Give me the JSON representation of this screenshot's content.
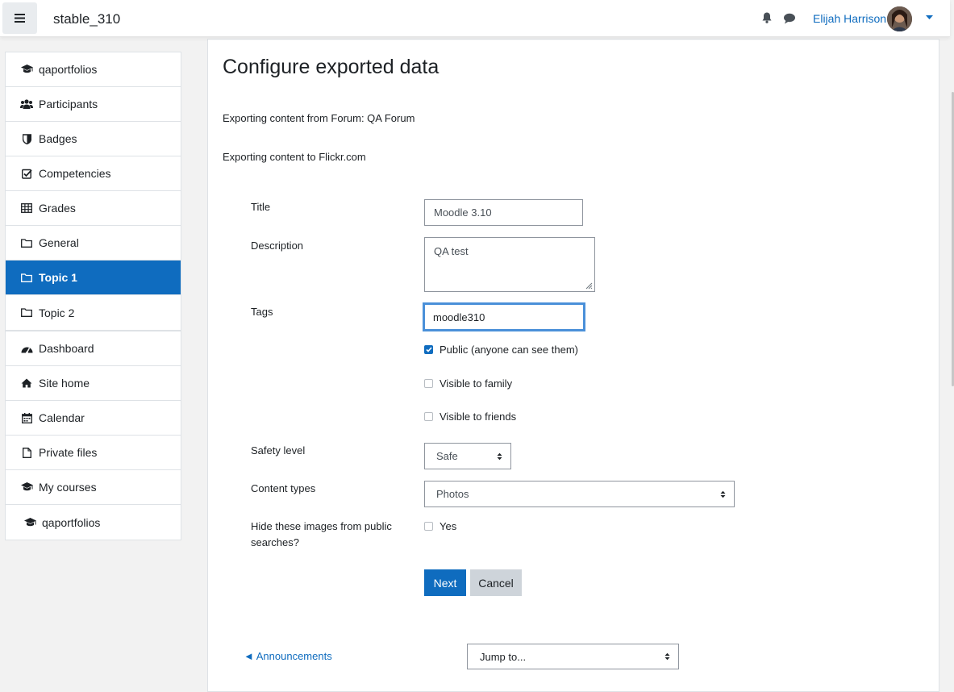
{
  "navbar": {
    "site_name": "stable_310",
    "user_name": "Elijah Harrison",
    "icons": {
      "menu": "hamburger-icon",
      "notifications": "bell-icon",
      "messages": "chat-bubble-icon",
      "user_menu": "caret-down-icon"
    }
  },
  "sidebar": {
    "course_items": [
      {
        "label": "qaportfolios",
        "icon": "graduation-cap-icon"
      },
      {
        "label": "Participants",
        "icon": "users-icon"
      },
      {
        "label": "Badges",
        "icon": "shield-icon"
      },
      {
        "label": "Competencies",
        "icon": "check-square-icon"
      },
      {
        "label": "Grades",
        "icon": "table-icon"
      },
      {
        "label": "General",
        "icon": "folder-icon"
      },
      {
        "label": "Topic 1",
        "icon": "folder-icon",
        "active": true
      },
      {
        "label": "Topic 2",
        "icon": "folder-icon"
      }
    ],
    "site_items": [
      {
        "label": "Dashboard",
        "icon": "dashboard-icon"
      },
      {
        "label": "Site home",
        "icon": "home-icon"
      },
      {
        "label": "Calendar",
        "icon": "calendar-icon"
      },
      {
        "label": "Private files",
        "icon": "file-icon"
      },
      {
        "label": "My courses",
        "icon": "graduation-cap-icon"
      },
      {
        "label": "qaportfolios",
        "icon": "graduation-cap-icon"
      }
    ]
  },
  "main": {
    "title": "Configure exported data",
    "export_from": "Exporting content from Forum: QA Forum",
    "export_to": "Exporting content to Flickr.com",
    "form": {
      "title_label": "Title",
      "title_value": "Moodle 3.10",
      "description_label": "Description",
      "description_value": "QA test",
      "tags_label": "Tags",
      "tags_value": "moodle310",
      "public_label": "Public (anyone can see them)",
      "public_checked": true,
      "family_label": "Visible to family",
      "family_checked": false,
      "friends_label": "Visible to friends",
      "friends_checked": false,
      "safety_label": "Safety level",
      "safety_value": "Safe",
      "content_types_label": "Content types",
      "content_types_value": "Photos",
      "hide_label": "Hide these images from public searches?",
      "hide_option_label": "Yes",
      "hide_checked": false,
      "next_label": "Next",
      "cancel_label": "Cancel"
    },
    "footer": {
      "prev_link": "◄ Announcements",
      "jump_to": "Jump to..."
    }
  },
  "colors": {
    "primary": "#0f6cbf",
    "focus_border": "#4a90d9",
    "secondary_button": "#ced4da"
  }
}
